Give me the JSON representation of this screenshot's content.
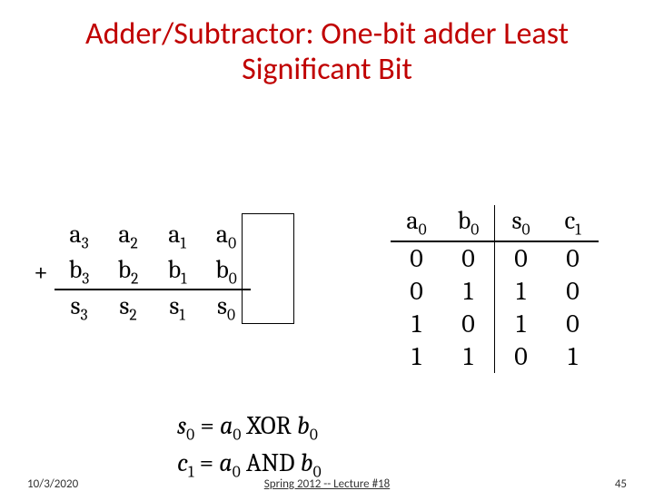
{
  "title": "Adder/Subtractor: One-bit adder Least Significant Bit",
  "addition": {
    "plus": "+",
    "row_a": [
      "a",
      "a",
      "a",
      "a"
    ],
    "row_a_sub": [
      "3",
      "2",
      "1",
      "0"
    ],
    "row_b": [
      "b",
      "b",
      "b",
      "b"
    ],
    "row_b_sub": [
      "3",
      "2",
      "1",
      "0"
    ],
    "row_s": [
      "s",
      "s",
      "s",
      "s"
    ],
    "row_s_sub": [
      "3",
      "2",
      "1",
      "0"
    ]
  },
  "truth": {
    "headers": [
      "a",
      "b",
      "s",
      "c"
    ],
    "headers_sub": [
      "0",
      "0",
      "0",
      "1"
    ],
    "rows": [
      [
        "0",
        "0",
        "0",
        "0"
      ],
      [
        "0",
        "1",
        "1",
        "0"
      ],
      [
        "1",
        "0",
        "1",
        "0"
      ],
      [
        "1",
        "1",
        "0",
        "1"
      ]
    ]
  },
  "eqs": {
    "s0": {
      "lhs": "s",
      "lsub": "0",
      "eq": " = ",
      "a": "a",
      "asub": "0",
      "op": " XOR ",
      "b": "b",
      "bsub": "0"
    },
    "c1": {
      "lhs": "c",
      "lsub": "1",
      "eq": " = ",
      "a": "a",
      "asub": "0",
      "op": " AND ",
      "b": "b",
      "bsub": "0"
    }
  },
  "footer": {
    "date": "10/3/2020",
    "mid": "Spring 2012 -- Lecture #18",
    "page": "45"
  }
}
